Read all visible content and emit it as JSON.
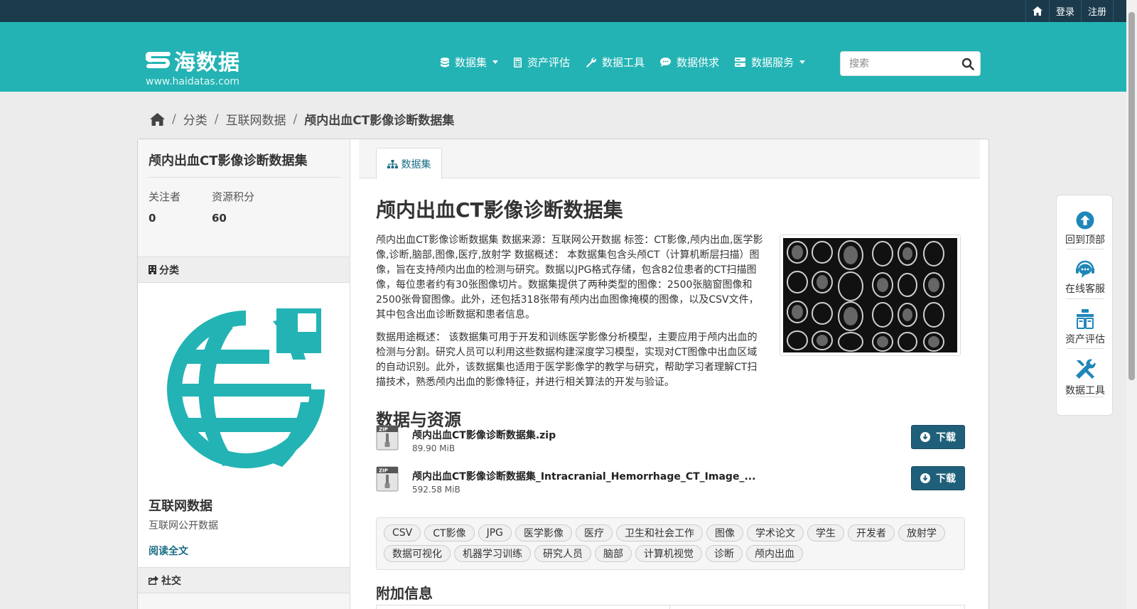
{
  "account": {
    "home_icon": "home-icon",
    "login": "登录",
    "register": "注册"
  },
  "brand": {
    "name": "海数据",
    "url": "www.haidatas.com"
  },
  "nav": {
    "items": [
      {
        "label": "数据集",
        "icon": "database-icon",
        "dropdown": true
      },
      {
        "label": "资产评估",
        "icon": "calculator-icon",
        "dropdown": false
      },
      {
        "label": "数据工具",
        "icon": "wrench-icon",
        "dropdown": false
      },
      {
        "label": "数据供求",
        "icon": "chat-icon",
        "dropdown": false
      },
      {
        "label": "数据服务",
        "icon": "server-icon",
        "dropdown": true
      }
    ]
  },
  "search": {
    "placeholder": "搜索"
  },
  "breadcrumb": {
    "home_icon": "home-icon",
    "items": [
      "分类",
      "互联网数据",
      "颅内出血CT影像诊断数据集"
    ]
  },
  "sidebar": {
    "title": "颅内出血CT影像诊断数据集",
    "followers_label": "关注者",
    "followers_value": "0",
    "points_label": "资源积分",
    "points_value": "60",
    "category_heading": "分类",
    "org_name": "互联网数据",
    "org_desc": "互联网公开数据",
    "read_more": "阅读全文",
    "social_heading": "社交"
  },
  "content": {
    "tab_label": "数据集",
    "title": "颅内出血CT影像诊断数据集",
    "description_1": "颅内出血CT影像诊断数据集 数据来源：互联网公开数据 标签：CT影像,颅内出血,医学影像,诊断,脑部,图像,医疗,放射学 数据概述： 本数据集包含头颅CT（计算机断层扫描）图像，旨在支持颅内出血的检测与研究。数据以JPG格式存储，包含82位患者的CT扫描图像，每位患者约有30张图像切片。数据集提供了两种类型的图像：2500张脑窗图像和2500张骨窗图像。此外，还包括318张带有颅内出血图像掩模的图像，以及CSV文件，其中包含出血诊断数据和患者信息。",
    "description_2": "数据用途概述： 该数据集可用于开发和训练医学影像分析模型，主要应用于颅内出血的检测与分割。研究人员可以利用这些数据构建深度学习模型，实现对CT图像中出血区域的自动识别。此外，该数据集也适用于医学影像学的教学与研究，帮助学习者理解CT扫描技术，熟悉颅内出血的影像特征，并进行相关算法的开发与验证。",
    "resources_heading": "数据与资源",
    "resources": [
      {
        "name": "颅内出血CT影像诊断数据集.zip",
        "size": "89.90 MiB",
        "button": "下载"
      },
      {
        "name": "颅内出血CT影像诊断数据集_Intracranial_Hemorrhage_CT_Image_...",
        "size": "592.58 MiB",
        "button": "下载"
      }
    ],
    "tags": [
      "CSV",
      "CT影像",
      "JPG",
      "医学影像",
      "医疗",
      "卫生和社会工作",
      "图像",
      "学术论文",
      "学生",
      "开发者",
      "放射学",
      "数据可视化",
      "机器学习训练",
      "研究人员",
      "脑部",
      "计算机视觉",
      "诊断",
      "颅内出血"
    ],
    "extra_heading": "附加信息"
  },
  "float_tools": {
    "items": [
      {
        "label": "回到顶部",
        "icon": "arrow-up-circle-icon"
      },
      {
        "label": "在线客服",
        "icon": "customer-service-icon"
      },
      {
        "label": "资产评估",
        "icon": "clipboard-icon"
      },
      {
        "label": "数据工具",
        "icon": "tools-icon"
      }
    ]
  },
  "colors": {
    "topbar": "#1b3b4d",
    "masthead": "#23b3b4",
    "accent": "#1f5f7a",
    "link": "#1a6e86"
  }
}
